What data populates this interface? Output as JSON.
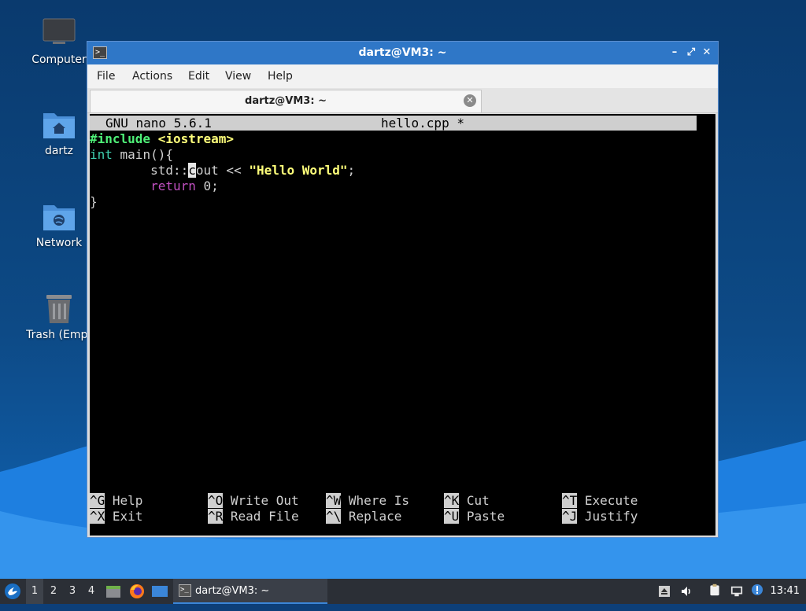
{
  "desktop": {
    "icons": [
      {
        "label": "Computer",
        "icon": "computer-icon"
      },
      {
        "label": "dartz",
        "icon": "home-folder-icon"
      },
      {
        "label": "Network",
        "icon": "network-folder-icon"
      },
      {
        "label": "Trash (Empt",
        "icon": "trash-icon"
      }
    ]
  },
  "window": {
    "title": "dartz@VM3: ~",
    "controls": {
      "minimize": "–",
      "maximize": "⤢",
      "close": "✕"
    },
    "menu": [
      "File",
      "Actions",
      "Edit",
      "View",
      "Help"
    ],
    "tab": {
      "label": "dartz@VM3: ~",
      "close": "✕"
    }
  },
  "nano": {
    "version": "GNU nano 5.6.1",
    "filename": "hello.cpp *",
    "code": {
      "l1a": "#include",
      "l1b": " ",
      "l1c": "<iostream>",
      "l2a": "int",
      "l2b": " main(){",
      "l3a": "        std::",
      "l3cursor": "c",
      "l3b": "out << ",
      "l3c": "\"Hello World\"",
      "l3d": ";",
      "l4a": "        ",
      "l4b": "return",
      "l4c": " 0;",
      "l5": "}"
    },
    "shortcuts": [
      {
        "key": "^G",
        "action": "Help"
      },
      {
        "key": "^O",
        "action": "Write Out"
      },
      {
        "key": "^W",
        "action": "Where Is"
      },
      {
        "key": "^K",
        "action": "Cut"
      },
      {
        "key": "^T",
        "action": "Execute"
      },
      {
        "key": "^X",
        "action": "Exit"
      },
      {
        "key": "^R",
        "action": "Read File"
      },
      {
        "key": "^\\",
        "action": "Replace"
      },
      {
        "key": "^U",
        "action": "Paste"
      },
      {
        "key": "^J",
        "action": "Justify"
      }
    ]
  },
  "taskbar": {
    "workspaces": [
      "1",
      "2",
      "3",
      "4"
    ],
    "active_workspace": "1",
    "task_label": "dartz@VM3: ~",
    "clock": "13:41",
    "accent": "#3b86d8"
  }
}
